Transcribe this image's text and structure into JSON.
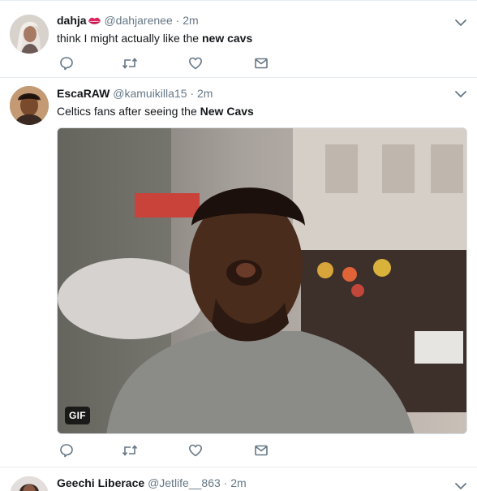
{
  "tweets": [
    {
      "fullname": "dahja",
      "username": "@dahjarenee",
      "dot": "·",
      "time": "2m",
      "text_before": "think I might actually like the ",
      "text_bold": "new cavs",
      "text_after": ""
    },
    {
      "fullname": "EscaRAW",
      "username": "@kamuikilla15",
      "dot": "·",
      "time": "2m",
      "text_before": "Celtics fans after seeing the ",
      "text_bold": "New Cavs",
      "text_after": "",
      "media_badge": "GIF"
    },
    {
      "fullname": "Geechi Liberace",
      "username": "@Jetlife__863",
      "dot": "·",
      "time": "2m"
    }
  ],
  "icons": {
    "reply": "reply-icon",
    "retweet": "retweet-icon",
    "like": "heart-icon",
    "message": "envelope-icon",
    "caret": "chevron-down-icon",
    "emoji": "kiss-lips-emoji"
  },
  "colors": {
    "icon_gray": "#657786",
    "text": "#14171a",
    "divider": "#e6ecf0",
    "lips": "#e0245e"
  }
}
